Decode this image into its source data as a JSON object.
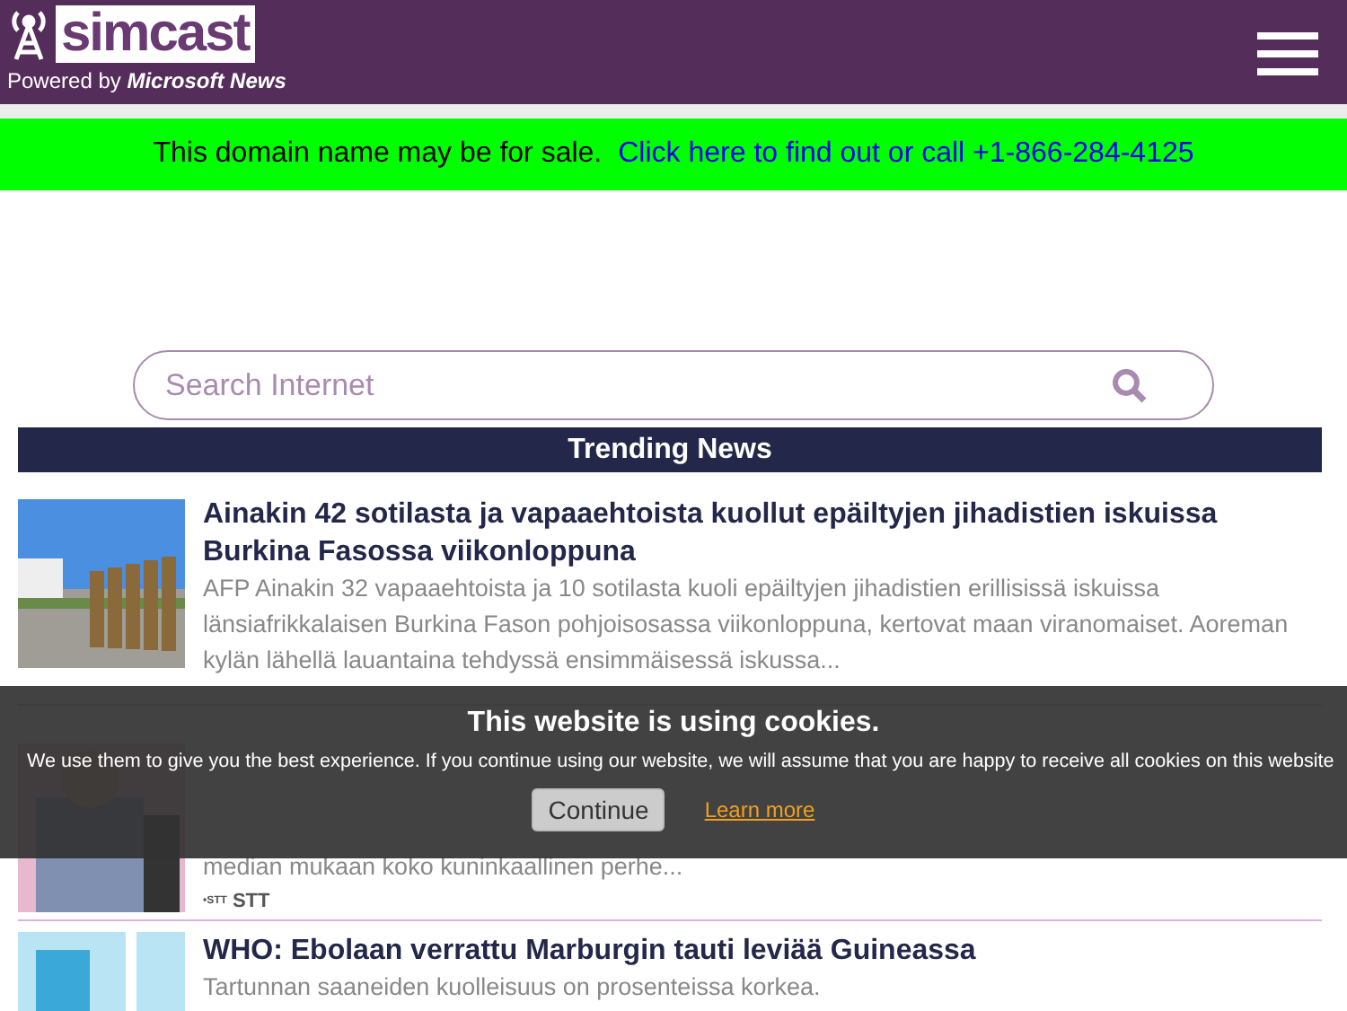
{
  "header": {
    "logo_text": "simcast",
    "powered_by": "Powered by ",
    "powered_brand": "Microsoft News"
  },
  "sale_banner": {
    "text": "This domain name may be for sale.",
    "link": "Click here to find out or call +1-866-284-4125"
  },
  "search": {
    "placeholder": "Search Internet"
  },
  "trending": {
    "title": "Trending News"
  },
  "articles": [
    {
      "title": "Ainakin 42 sotilasta ja vapaaehtoista kuollut epäiltyjen jihadistien iskuissa Burkina Fasossa viikonloppuna",
      "summary": "AFP Ainakin 32 vapaaehtoista ja 10 sotilasta kuoli epäiltyjen jihadistien erillisissä iskuissa länsiafrikkalaisen Burkina Fason pohjoisosassa viikonloppuna, kertovat maan viranomaiset. Aoreman kylän lähellä lauantaina tehdyssä ensimmäisessä iskussa..."
    },
    {
      "summary": "median mukaan koko kuninkaallinen perhe...",
      "source_logo": "•STT",
      "source": "STT"
    },
    {
      "title": "WHO: Ebolaan verrattu Marburgin tauti leviää Guineassa",
      "summary": "Tartunnan saaneiden kuolleisuus on prosenteissa korkea."
    }
  ],
  "cookie_notice": {
    "title": "This website is using cookies.",
    "text": "We use them to give you the best experience. If you continue using our website, we will assume that you are happy to receive all cookies on this website",
    "button": "Continue",
    "link": "Learn more"
  }
}
